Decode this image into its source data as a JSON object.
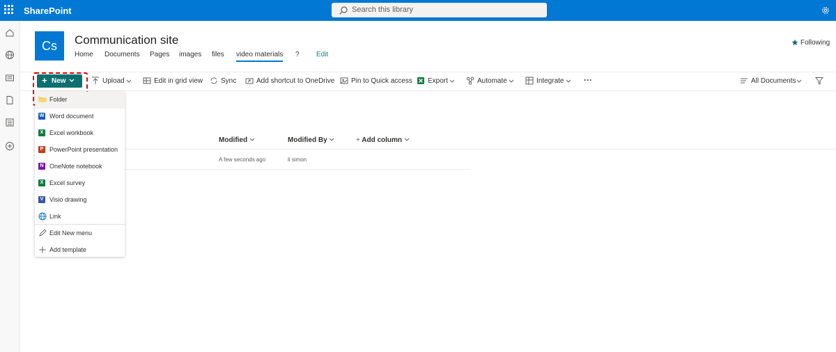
{
  "header": {
    "brand": "SharePoint",
    "search_placeholder": "Search this library"
  },
  "site": {
    "logo_text": "Cs",
    "title": "Communication site",
    "nav": [
      "Home",
      "Documents",
      "Pages",
      "images",
      "files",
      "video materials",
      "?",
      "Edit"
    ],
    "following": "Following"
  },
  "toolbar": {
    "new": "New",
    "upload": "Upload",
    "grid": "Edit in grid view",
    "sync": "Sync",
    "shortcut": "Add shortcut to OneDrive",
    "pin": "Pin to Quick access",
    "export": "Export",
    "automate": "Automate",
    "integrate": "Integrate",
    "more": "···",
    "view": "All Documents"
  },
  "new_menu": {
    "items": [
      "Folder",
      "Word document",
      "Excel workbook",
      "PowerPoint presentation",
      "OneNote notebook",
      "Excel survey",
      "Visio drawing",
      "Link"
    ],
    "edit": "Edit New menu",
    "add_template": "Add template"
  },
  "table": {
    "columns": {
      "modified": "Modified",
      "modified_by": "Modified By",
      "add_column": "Add column"
    },
    "rows": [
      {
        "modified": "A few seconds ago",
        "modified_by": "li simon"
      }
    ]
  },
  "colors": {
    "accent": "#0078d4",
    "new_button": "#0d6f6f",
    "highlight_dash": "#e00000"
  }
}
